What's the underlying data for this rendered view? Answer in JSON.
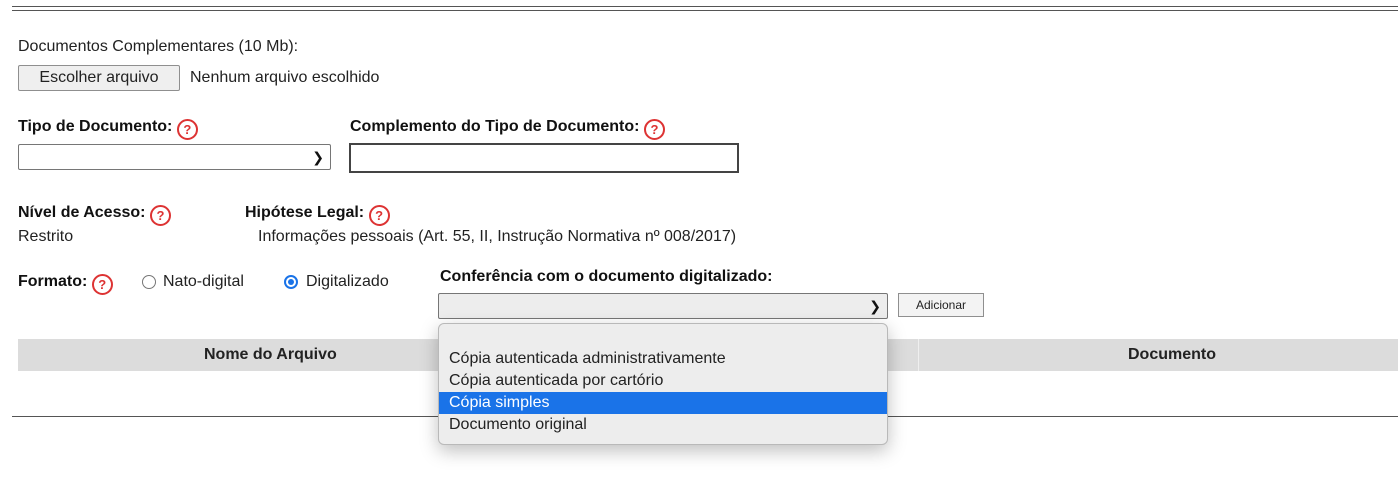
{
  "complementary_docs": {
    "label": "Documentos Complementares (10 Mb):",
    "choose_button": "Escolher arquivo",
    "no_file": "Nenhum arquivo escolhido"
  },
  "document_type": {
    "label": "Tipo de Documento:",
    "value": ""
  },
  "type_complement": {
    "label": "Complemento do Tipo de Documento:",
    "value": ""
  },
  "access_level": {
    "label": "Nível de Acesso:",
    "value": "Restrito"
  },
  "legal_hypothesis": {
    "label": "Hipótese Legal:",
    "value": "Informações pessoais (Art. 55, II, Instrução Normativa nº 008/2017)"
  },
  "format": {
    "label": "Formato:",
    "options": [
      "Nato-digital",
      "Digitalizado"
    ],
    "selected": "Digitalizado"
  },
  "conference": {
    "label": "Conferência com o documento digitalizado:",
    "value": "",
    "add_button": "Adicionar",
    "options": [
      "Cópia autenticada administrativamente",
      "Cópia autenticada por cartório",
      "Cópia simples",
      "Documento original"
    ],
    "highlighted": "Cópia simples"
  },
  "table": {
    "headers": [
      "Nome do Arquivo",
      "Documento"
    ]
  },
  "help_symbol": "?",
  "icons": {
    "help": "help-circle-icon",
    "chevron": "chevron-down-icon"
  },
  "colors": {
    "help": "#dd3333",
    "accent": "#1a73e8",
    "header_bg": "#dcdcdc"
  }
}
